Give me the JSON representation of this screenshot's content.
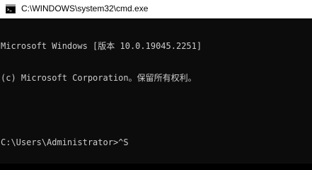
{
  "window": {
    "title": "C:\\WINDOWS\\system32\\cmd.exe",
    "icon": "cmd-console-icon"
  },
  "console": {
    "lines": [
      "Microsoft Windows [版本 10.0.19045.2251]",
      "(c) Microsoft Corporation。保留所有权利。"
    ],
    "prompt": "C:\\Users\\Administrator>",
    "input": "^S"
  },
  "colors": {
    "background": "#0c0c0c",
    "text": "#cccccc",
    "titlebar": "#ffffff"
  }
}
